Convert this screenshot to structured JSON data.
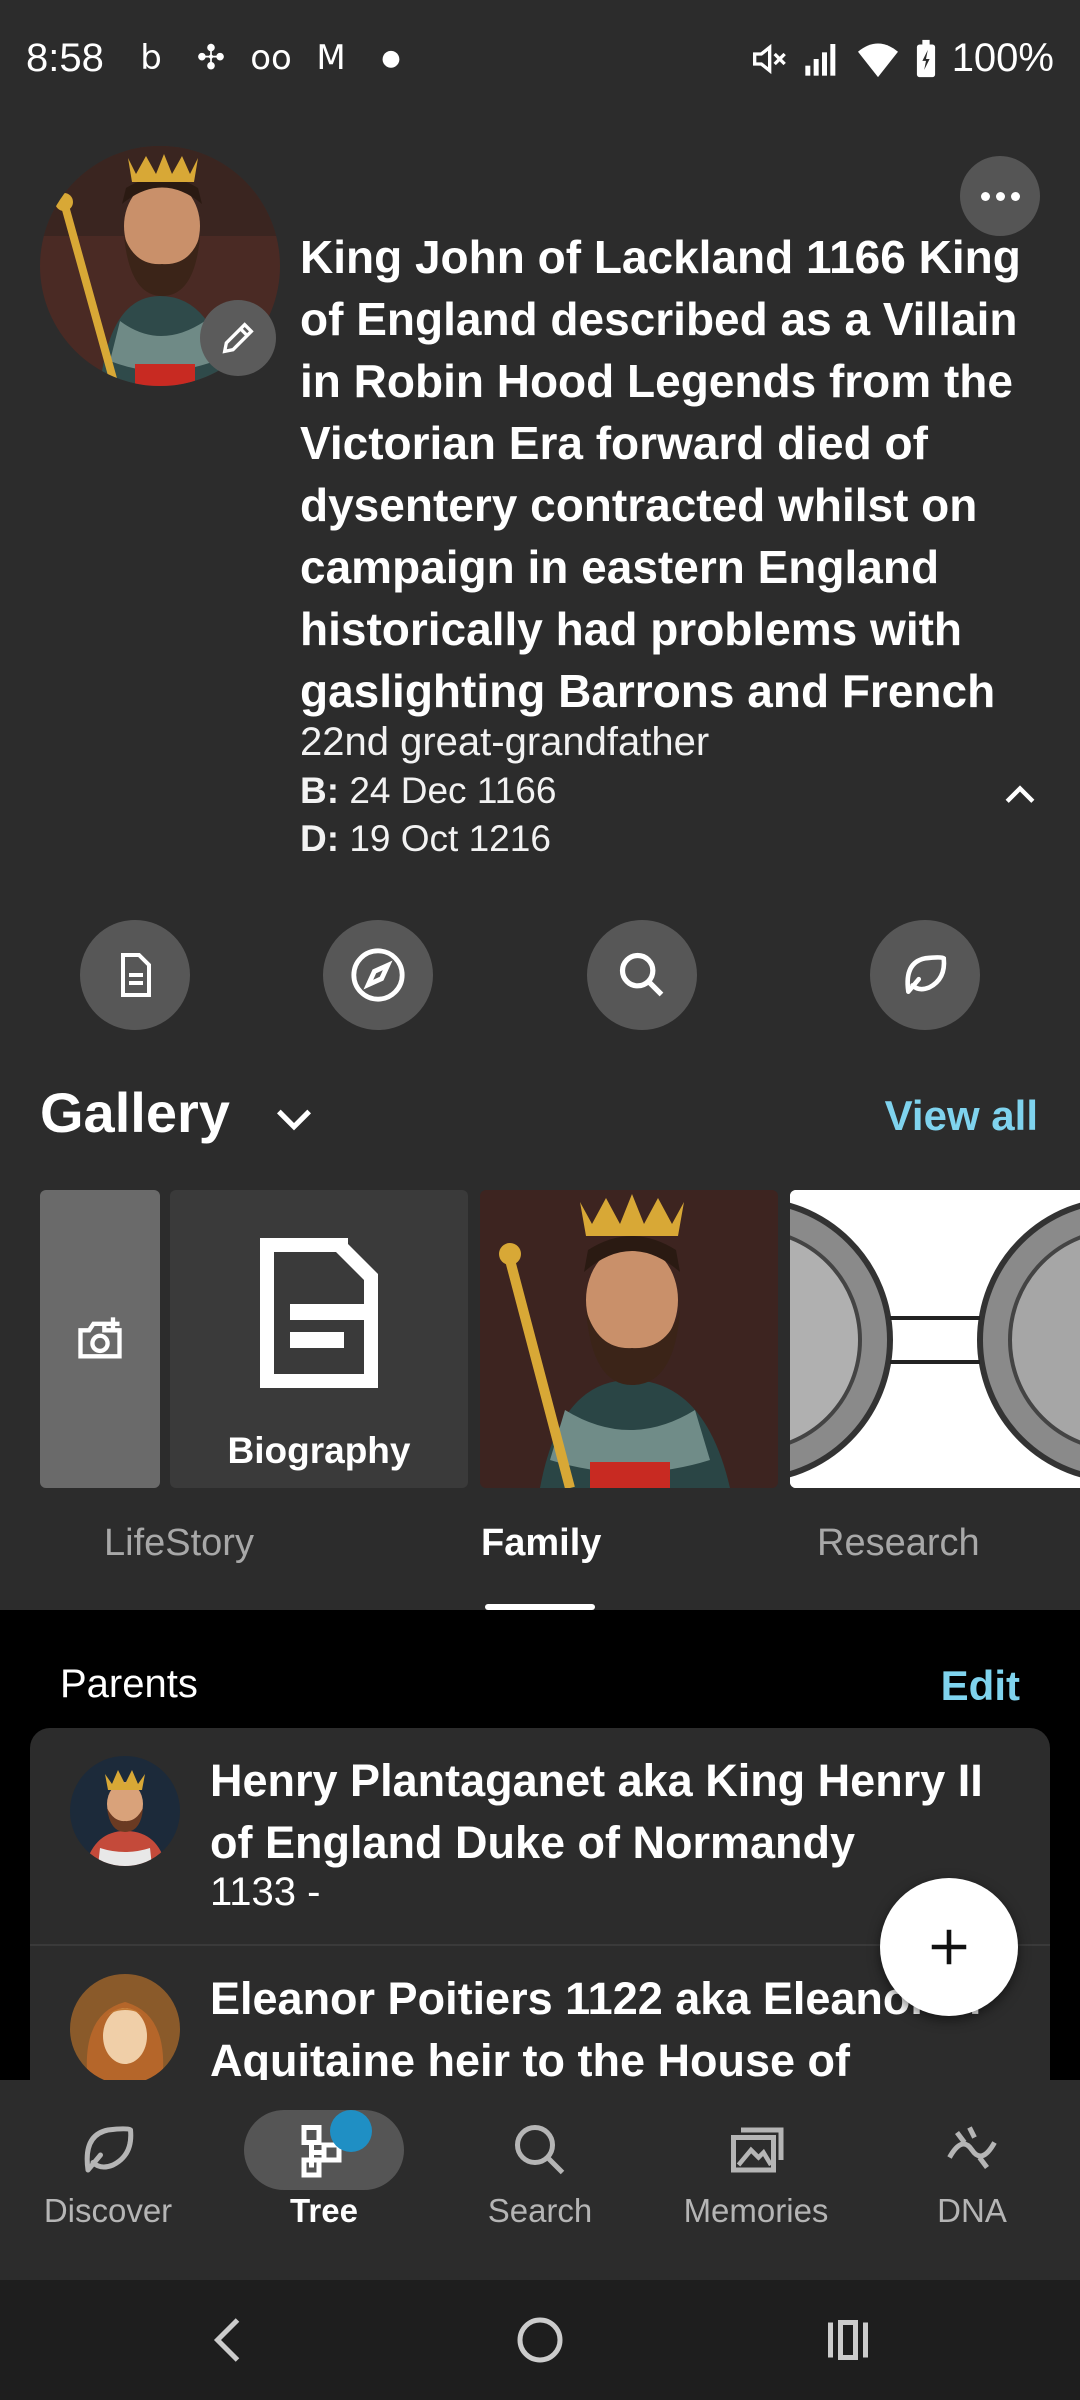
{
  "status_bar": {
    "time": "8:58",
    "battery": "100%",
    "left_icons": [
      "b-icon",
      "pinwheel-icon",
      "voicemail-icon",
      "gmail-icon",
      "dot-icon"
    ],
    "right_icons": [
      "mute-icon",
      "signal-icon",
      "wifi-icon",
      "battery-icon"
    ]
  },
  "profile": {
    "name": "King John of Lackland 1166 King of England described as a Villain in Robin Hood Legends from the Victorian Era forward died of dysentery contracted whilst on campaign in eastern England historically had problems with gaslighting Barrons and French",
    "relationship": "22nd great-grandfather",
    "birth_label": "B:",
    "birth": "24 Dec 1166",
    "death_label": "D:",
    "death": "19 Oct 1216"
  },
  "actions": [
    "facts-icon",
    "compass-icon",
    "search-icon",
    "leaf-icon"
  ],
  "gallery": {
    "title": "Gallery",
    "view_all": "View all",
    "biography_label": "Biography"
  },
  "tabs": [
    {
      "label": "LifeStory",
      "active": false
    },
    {
      "label": "Family",
      "active": true
    },
    {
      "label": "Research",
      "active": false
    }
  ],
  "parents": {
    "title": "Parents",
    "edit": "Edit",
    "items": [
      {
        "name": "Henry Plantaganet aka King Henry II of England Duke of Normandy",
        "years": "1133 -"
      },
      {
        "name": "Eleanor Poitiers 1122 aka Eleanor of Aquitaine heir to the House of",
        "years": ""
      }
    ]
  },
  "bottom_nav": [
    {
      "label": "Discover",
      "icon": "leaf-icon",
      "active": false
    },
    {
      "label": "Tree",
      "icon": "tree-icon",
      "active": true
    },
    {
      "label": "Search",
      "icon": "search-icon",
      "active": false
    },
    {
      "label": "Memories",
      "icon": "photos-icon",
      "active": false
    },
    {
      "label": "DNA",
      "icon": "dna-icon",
      "active": false
    }
  ],
  "colors": {
    "background": "#2c2c2c",
    "accent": "#7fd3ee",
    "notification_dot": "#1f8fc4"
  }
}
